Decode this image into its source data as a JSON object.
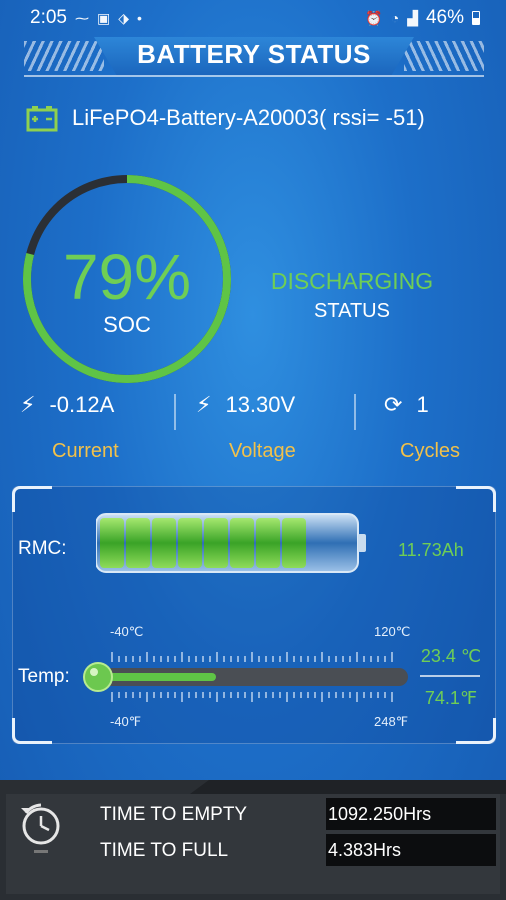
{
  "status_bar": {
    "time": "2:05",
    "battery_percent": "46%",
    "icons_left": [
      "minus-icon",
      "image-icon",
      "tag-icon",
      "dot-icon"
    ],
    "icons_right": [
      "alarm-icon",
      "wifi-icon",
      "signal-icon",
      "battery-icon"
    ]
  },
  "header": {
    "title": "BATTERY STATUS"
  },
  "device": {
    "name": "LiFePO4-Battery-A20003( rssi= -51)"
  },
  "soc": {
    "value": "79%",
    "label": "SOC",
    "fraction": 0.79
  },
  "status": {
    "value": "DISCHARGING",
    "label": "STATUS"
  },
  "metrics": {
    "current": {
      "value": "-0.12A",
      "label": "Current"
    },
    "voltage": {
      "value": "13.30V",
      "label": "Voltage"
    },
    "cycles": {
      "value": "1",
      "label": "Cycles"
    }
  },
  "rmc": {
    "label": "RMC:",
    "value": "11.73Ah",
    "level": 0.79
  },
  "temperature": {
    "label": "Temp:",
    "min_c": "-40℃",
    "max_c": "120℃",
    "min_f": "-40℉",
    "max_f": "248℉",
    "value_c": "23.4 ℃",
    "value_f": "74.1℉",
    "level": 0.4
  },
  "times": {
    "empty_label": "TIME TO EMPTY",
    "empty_value": "1092.250Hrs",
    "full_label": "TIME TO FULL",
    "full_value": "4.383Hrs"
  },
  "colors": {
    "accent_green": "#6fce55",
    "label_yellow": "#f2c14a",
    "background_blue": "#1d6fc9"
  }
}
